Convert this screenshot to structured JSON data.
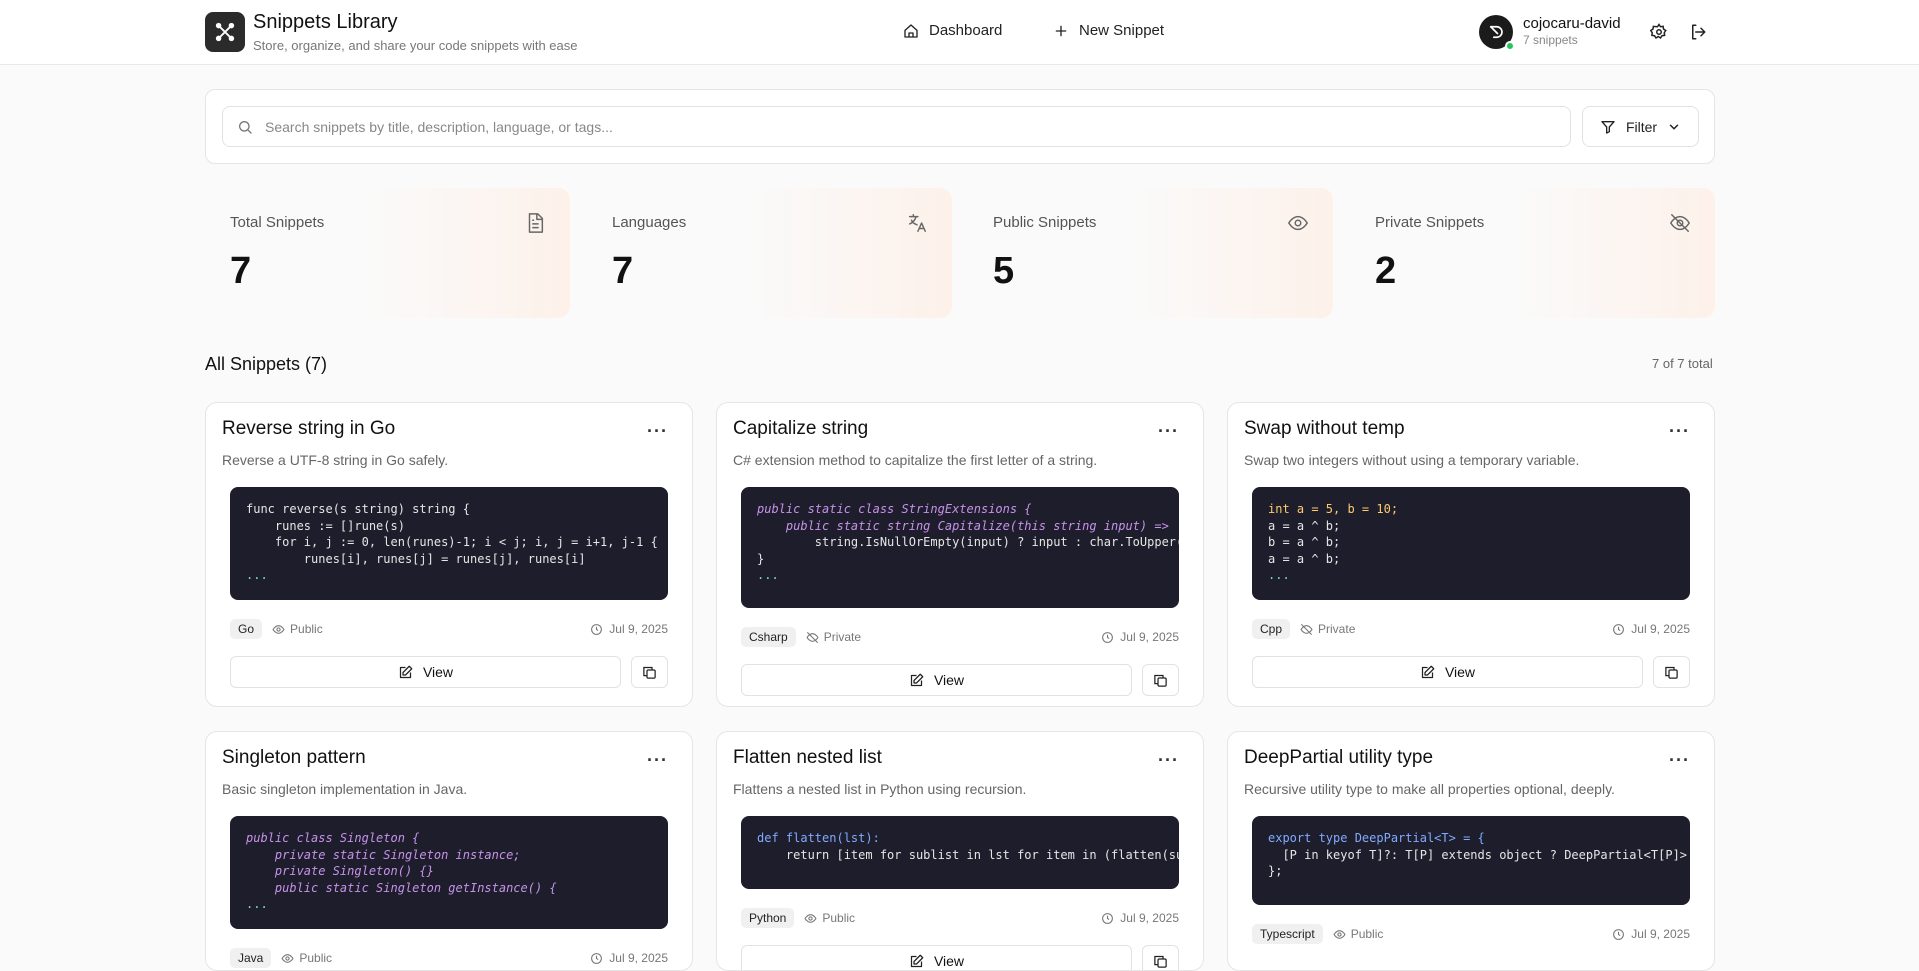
{
  "header": {
    "title": "Snippets Library",
    "subtitle": "Store, organize, and share your code snippets with ease",
    "nav": {
      "dashboard": "Dashboard",
      "new_snippet": "New Snippet"
    },
    "user": {
      "name": "cojocaru-david",
      "count": "7 snippets"
    }
  },
  "search": {
    "placeholder": "Search snippets by title, description, language, or tags...",
    "filter_label": "Filter"
  },
  "stats": [
    {
      "label": "Total Snippets",
      "value": "7",
      "icon": "file-text-icon"
    },
    {
      "label": "Languages",
      "value": "7",
      "icon": "languages-icon"
    },
    {
      "label": "Public Snippets",
      "value": "5",
      "icon": "eye-icon"
    },
    {
      "label": "Private Snippets",
      "value": "2",
      "icon": "eye-off-icon"
    }
  ],
  "section": {
    "title": "All Snippets (7)",
    "count": "7 of 7 total"
  },
  "cards": [
    {
      "title": "Reverse string in Go",
      "desc": "Reverse a UTF-8 string in Go safely.",
      "lang": "Go",
      "visibility": "Public",
      "date": "Jul 9, 2025",
      "view": "View"
    },
    {
      "title": "Capitalize string",
      "desc": "C# extension method to capitalize the first letter of a string.",
      "lang": "Csharp",
      "visibility": "Private",
      "date": "Jul 9, 2025",
      "view": "View"
    },
    {
      "title": "Swap without temp",
      "desc": "Swap two integers without using a temporary variable.",
      "lang": "Cpp",
      "visibility": "Private",
      "date": "Jul 9, 2025",
      "view": "View"
    },
    {
      "title": "Singleton pattern",
      "desc": "Basic singleton implementation in Java.",
      "lang": "Java",
      "visibility": "Public",
      "date": "Jul 9, 2025",
      "view": "View"
    },
    {
      "title": "Flatten nested list",
      "desc": "Flattens a nested list in Python using recursion.",
      "lang": "Python",
      "visibility": "Public",
      "date": "Jul 9, 2025",
      "view": "View"
    },
    {
      "title": "DeepPartial utility type",
      "desc": "Recursive utility type to make all properties optional, deeply.",
      "lang": "Typescript",
      "visibility": "Public",
      "date": "Jul 9, 2025",
      "view": "View"
    }
  ],
  "code": {
    "go": [
      "func reverse(s string) string {",
      "    runes := []rune(s)",
      "    for i, j := 0, len(runes)-1; i < j; i, j = i+1, j-1 {",
      "        runes[i], runes[j] = runes[j], runes[i]",
      "..."
    ],
    "csharp": [
      "public static class StringExtensions {",
      "    public static string Capitalize(this string input) =>",
      "        string.IsNullOrEmpty(input) ? input : char.ToUpper(input",
      "}",
      "..."
    ],
    "cpp": [
      "int a = 5, b = 10;",
      "a = a ^ b;",
      "b = a ^ b;",
      "a = a ^ b;",
      "..."
    ],
    "java": [
      "public class Singleton {",
      "    private static Singleton instance;",
      "    private Singleton() {}",
      "    public static Singleton getInstance() {",
      "..."
    ],
    "python": [
      "def flatten(lst):",
      "    return [item for sublist in lst for item in (flatten(sublist"
    ],
    "ts": [
      "export type DeepPartial<T> = {",
      "  [P in keyof T]?: T[P] extends object ? DeepPartial<T[P]> : T[P",
      "};"
    ]
  }
}
